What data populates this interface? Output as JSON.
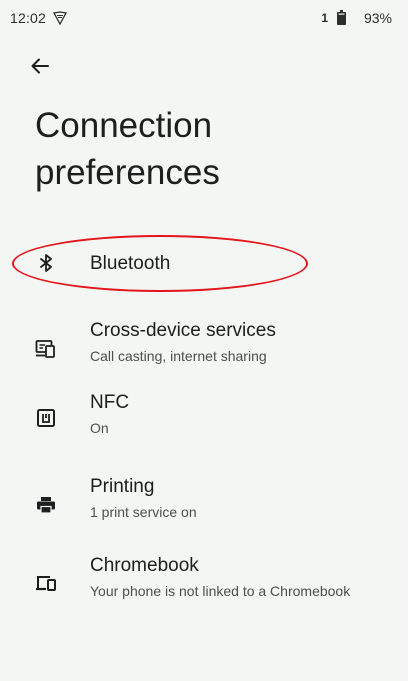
{
  "status_bar": {
    "time": "12:02",
    "sim_indicator": "1",
    "battery_percent": "93%",
    "vpn_icon": "vpn-key-icon",
    "battery_icon": "battery-icon"
  },
  "header": {
    "back_icon": "arrow-back-icon",
    "title": "Connection preferences"
  },
  "items": [
    {
      "title": "Bluetooth",
      "subtitle": "",
      "icon": "bluetooth-icon"
    },
    {
      "title": "Cross-device services",
      "subtitle": "Call casting, internet sharing",
      "icon": "cross-device-icon"
    },
    {
      "title": "NFC",
      "subtitle": "On",
      "icon": "nfc-icon"
    },
    {
      "title": "Printing",
      "subtitle": "1 print service on",
      "icon": "print-icon"
    },
    {
      "title": "Chromebook",
      "subtitle": "Your phone is not linked to a Chromebook",
      "icon": "chromebook-icon"
    }
  ],
  "annotation": {
    "highlight_color": "#e4151b",
    "highlighted_item": "Bluetooth"
  },
  "colors": {
    "background": "#f3f6f3",
    "text_primary": "#1c1f1d",
    "text_secondary": "#4a514c"
  }
}
